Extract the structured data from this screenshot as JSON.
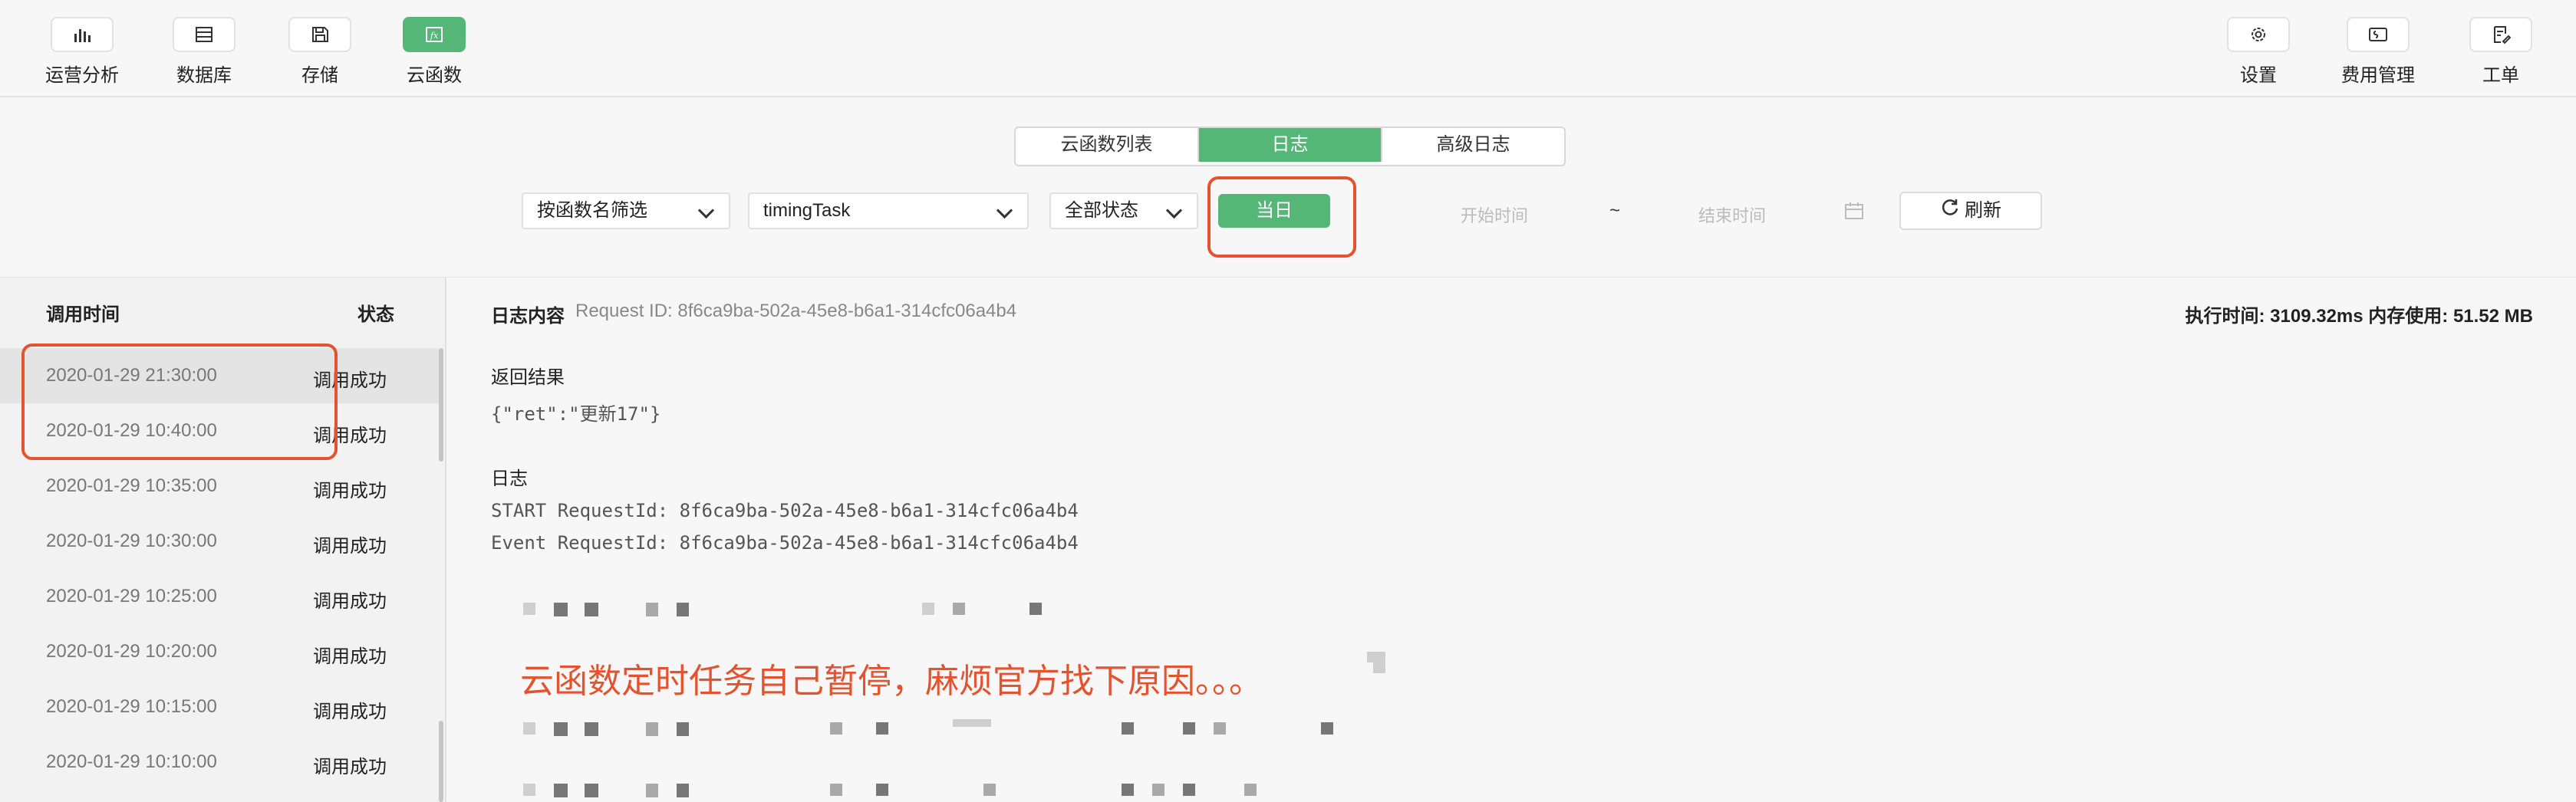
{
  "nav": {
    "left": [
      {
        "label": "运营分析",
        "icon": "bar-chart-icon",
        "active": false
      },
      {
        "label": "数据库",
        "icon": "database-icon",
        "active": false
      },
      {
        "label": "存储",
        "icon": "storage-icon",
        "active": false
      },
      {
        "label": "云函数",
        "icon": "function-icon",
        "active": true
      }
    ],
    "right": [
      {
        "label": "设置",
        "icon": "gear-icon"
      },
      {
        "label": "费用管理",
        "icon": "billing-icon"
      },
      {
        "label": "工单",
        "icon": "ticket-icon"
      }
    ]
  },
  "tabs": [
    {
      "label": "云函数列表",
      "active": false
    },
    {
      "label": "日志",
      "active": true
    },
    {
      "label": "高级日志",
      "active": false
    }
  ],
  "filters": {
    "filter_mode": "按函数名筛选",
    "function_name": "timingTask",
    "status": "全部状态",
    "today_label": "当日",
    "start_placeholder": "开始时间",
    "range_separator": "~",
    "end_placeholder": "结束时间",
    "refresh_label": "刷新"
  },
  "sidebar": {
    "col_time": "调用时间",
    "col_status": "状态",
    "rows": [
      {
        "time": "2020-01-29 21:30:00",
        "status": "调用成功",
        "selected": true
      },
      {
        "time": "2020-01-29 10:40:00",
        "status": "调用成功",
        "selected": false
      },
      {
        "time": "2020-01-29 10:35:00",
        "status": "调用成功",
        "selected": false
      },
      {
        "time": "2020-01-29 10:30:00",
        "status": "调用成功",
        "selected": false
      },
      {
        "time": "2020-01-29 10:25:00",
        "status": "调用成功",
        "selected": false
      },
      {
        "time": "2020-01-29 10:20:00",
        "status": "调用成功",
        "selected": false
      },
      {
        "time": "2020-01-29 10:15:00",
        "status": "调用成功",
        "selected": false
      },
      {
        "time": "2020-01-29 10:10:00",
        "status": "调用成功",
        "selected": false
      }
    ]
  },
  "log": {
    "title": "日志内容",
    "request_id": "Request ID: 8f6ca9ba-502a-45e8-b6a1-314cfc06a4b4",
    "metrics": "执行时间: 3109.32ms   内存使用: 51.52 MB",
    "return_label": "返回结果",
    "return_value": "{\"ret\":\"更新17\"}",
    "log_label": "日志",
    "log_lines": [
      "START RequestId: 8f6ca9ba-502a-45e8-b6a1-314cfc06a4b4",
      "Event RequestId: 8f6ca9ba-502a-45e8-b6a1-314cfc06a4b4"
    ]
  },
  "annotation": "云函数定时任务自己暂停，麻烦官方找下原因。。。",
  "colors": {
    "accent": "#54b777",
    "highlight": "#e5532e"
  }
}
